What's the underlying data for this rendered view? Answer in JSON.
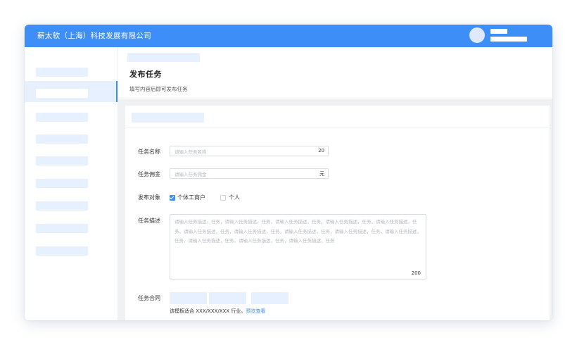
{
  "app": {
    "title": "薪太软（上海）科技发展有限公司"
  },
  "sidebar": {
    "items": [
      "",
      "",
      "",
      "",
      "",
      "",
      "",
      "",
      ""
    ],
    "active_index": 1
  },
  "header": {
    "title": "发布任务",
    "subtitle": "填写内容后即可发布任务"
  },
  "form": {
    "task_name": {
      "label": "任务名称",
      "placeholder": "请输入任务名称",
      "counter": "20"
    },
    "commission": {
      "label": "任务佣金",
      "placeholder": "请输入任务佣金",
      "unit": "元"
    },
    "target": {
      "label": "发布对象",
      "options": [
        {
          "label": "个体工商户",
          "checked": true
        },
        {
          "label": "个人",
          "checked": false
        }
      ]
    },
    "description": {
      "label": "任务描述",
      "placeholder": "请输入任务描述，任务，请输入任务描述，任务，请输入任务描述，任务，请输入任务描述，任务，请输入任务描述，任务，请输入任务描述，任务，请输入任务描述，任务，请输入任务描述，任务，请输入任务描述，任务，请输入任务描述，任务，请输入任务描述，任务，请输入任务描述，任务，请输入任务描述，任务",
      "counter": "200"
    },
    "contract": {
      "label": "任务合同",
      "hint": "该模板适合 XXX/XXX/XXX 行业。",
      "link": "预览查看"
    }
  },
  "colors": {
    "primary": "#3e8ef7",
    "placeholder_block": "#e6f0fe"
  }
}
